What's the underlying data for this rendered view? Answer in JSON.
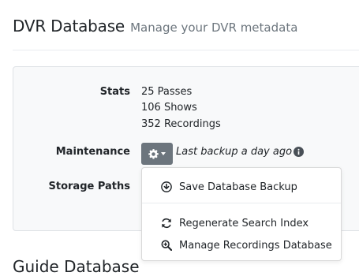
{
  "header": {
    "title": "DVR Database",
    "subtitle": "Manage your DVR metadata"
  },
  "stats": {
    "label": "Stats",
    "passes": "25 Passes",
    "shows": "106 Shows",
    "recordings": "352 Recordings"
  },
  "maintenance": {
    "label": "Maintenance",
    "backup_status": "Last backup a day ago",
    "menu": {
      "items": [
        {
          "label": "Save Database Backup",
          "icon": "download-icon"
        },
        {
          "label": "Regenerate Search Index",
          "icon": "refresh-icon"
        },
        {
          "label": "Manage Recordings Database",
          "icon": "search-plus-icon"
        }
      ]
    }
  },
  "storage": {
    "label": "Storage Paths"
  },
  "next_section": {
    "title": "Guide Database"
  }
}
